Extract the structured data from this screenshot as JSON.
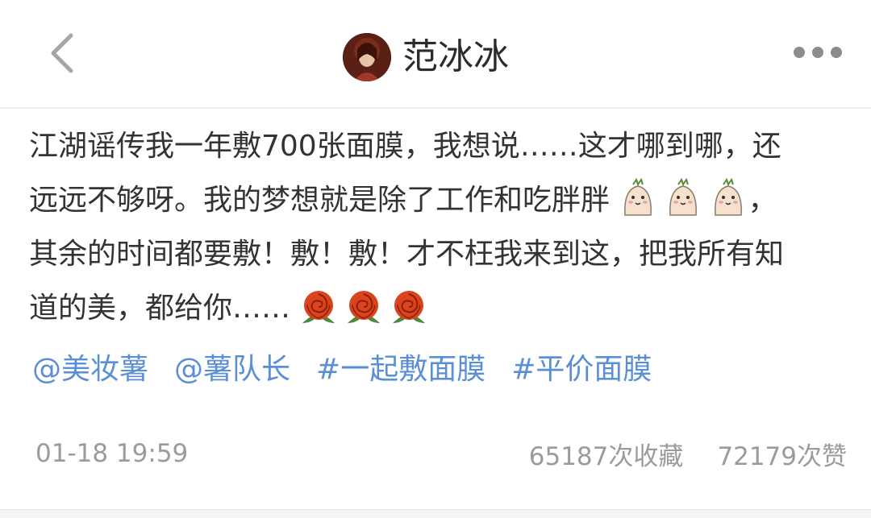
{
  "header": {
    "user_name": "范冰冰"
  },
  "post": {
    "line1": "江湖谣传我一年敷700张面膜，我想说……这才哪到哪，还",
    "line2": "远远不够呀。我的梦想就是除了工作和吃胖胖",
    "line2_end": "，",
    "line3": "其余的时间都要敷！敷！敷！才不枉我来到这，把我所有知",
    "line4": "道的美，都给你……",
    "emoji_cute": "cute-face-emoji",
    "emoji_rose": "rose-emoji"
  },
  "tags": [
    "@美妆薯",
    "@薯队长",
    "#一起敷面膜",
    "#平价面膜"
  ],
  "meta": {
    "time": "01-18 19:59",
    "favorites": "65187次收藏",
    "likes": "72179次赞"
  },
  "colors": {
    "link": "#5a8fd6",
    "text": "#333333",
    "muted": "#9b9b9b"
  }
}
